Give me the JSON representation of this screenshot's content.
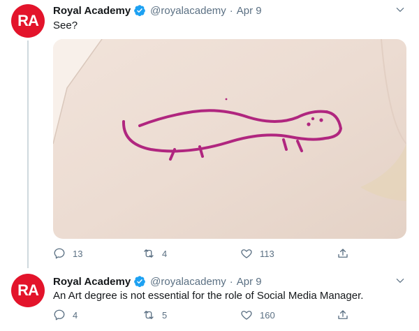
{
  "tweets": [
    {
      "avatar_text": "RA",
      "name": "Royal Academy",
      "handle": "@royalacademy",
      "separator": "·",
      "date": "Apr 9",
      "text": "See?",
      "media_icon": "photo-of-drawn-lizard",
      "replies": "13",
      "retweets": "4",
      "likes": "113"
    },
    {
      "avatar_text": "RA",
      "name": "Royal Academy",
      "handle": "@royalacademy",
      "separator": "·",
      "date": "Apr 9",
      "text": "An Art degree is not essential for the role of Social Media Manager.",
      "replies": "4",
      "retweets": "5",
      "likes": "160"
    }
  ],
  "colors": {
    "brand_red": "#e3142b",
    "verified_blue": "#1da1f2",
    "muted_text": "#5b7083",
    "marker_magenta": "#b0267f"
  }
}
